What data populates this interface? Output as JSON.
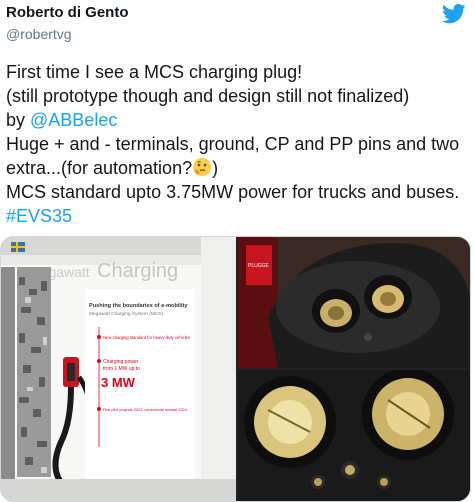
{
  "author": {
    "name": "Roberto di Gento",
    "handle": "@robertvg"
  },
  "brand": {
    "icon": "twitter-bird-icon",
    "color": "#1da1f2"
  },
  "tweet": {
    "line1": "First time I see a MCS charging plug!",
    "line2": "(still prototype though and design still not finalized)",
    "line3_prefix": "by ",
    "mention": "@ABBelec",
    "line4": "Huge + and - terminals, ground, CP and PP pins and two extra...(for automation?",
    "line4_emoji": "thinking-face-emoji",
    "line4_suffix": ")",
    "line5": "MCS standard upto 3.75MW power for trucks and buses. ",
    "hashtag": "#EVS35"
  },
  "photos": {
    "booth": {
      "title_faded": "Megawatt",
      "title_main": "Charging",
      "panel_heading": "Pushing the boundaries of e-mobility",
      "panel_sub": "Megawatt Charging System (MCS)",
      "bullet1": "New charging standard for heavy-duty vehicles",
      "bullet2_a": "Charging power",
      "bullet2_b": "from 1 MW up to",
      "big_value": "3 MW",
      "bullet3": "First pilot projects 2023, commercial release 2024"
    },
    "plug_closeup": {
      "badge": "PLUGGE"
    }
  }
}
